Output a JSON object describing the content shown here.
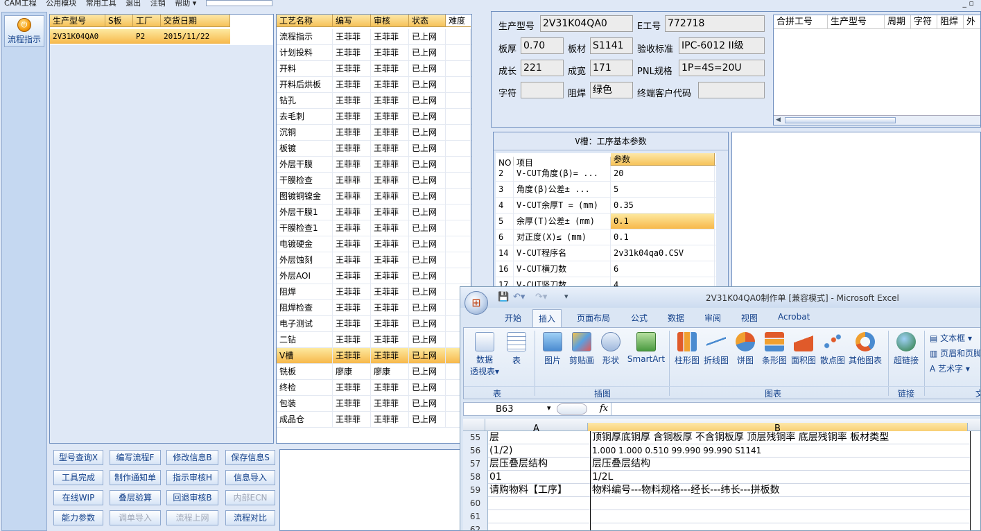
{
  "menu": {
    "items": [
      "CAM工程",
      "公用模块",
      "常用工具",
      "退出",
      "注销",
      "帮助 ▾"
    ],
    "window_controls": "_ ▫"
  },
  "leftbar": {
    "flow_button": "流程指示"
  },
  "model_table": {
    "headers": [
      "生产型号",
      "S板",
      "工厂",
      "交货日期"
    ],
    "rows": [
      [
        "2V31K04QA0",
        "",
        "P2",
        "2015/11/22"
      ]
    ]
  },
  "process_table": {
    "headers": [
      "工艺名称",
      "编写",
      "审核",
      "状态",
      "难度"
    ],
    "rows": [
      [
        "流程指示",
        "王菲菲",
        "王菲菲",
        "已上网"
      ],
      [
        "计划投料",
        "王菲菲",
        "王菲菲",
        "已上网"
      ],
      [
        "开料",
        "王菲菲",
        "王菲菲",
        "已上网"
      ],
      [
        "开料后烘板",
        "王菲菲",
        "王菲菲",
        "已上网"
      ],
      [
        "钻孔",
        "王菲菲",
        "王菲菲",
        "已上网"
      ],
      [
        "去毛刺",
        "王菲菲",
        "王菲菲",
        "已上网"
      ],
      [
        "沉铜",
        "王菲菲",
        "王菲菲",
        "已上网"
      ],
      [
        "板镀",
        "王菲菲",
        "王菲菲",
        "已上网"
      ],
      [
        "外层干膜",
        "王菲菲",
        "王菲菲",
        "已上网"
      ],
      [
        "干膜检查",
        "王菲菲",
        "王菲菲",
        "已上网"
      ],
      [
        "图镀铜镍金",
        "王菲菲",
        "王菲菲",
        "已上网"
      ],
      [
        "外层干膜1",
        "王菲菲",
        "王菲菲",
        "已上网"
      ],
      [
        "干膜检查1",
        "王菲菲",
        "王菲菲",
        "已上网"
      ],
      [
        "电镀硬金",
        "王菲菲",
        "王菲菲",
        "已上网"
      ],
      [
        "外层蚀刻",
        "王菲菲",
        "王菲菲",
        "已上网"
      ],
      [
        "外层AOI",
        "王菲菲",
        "王菲菲",
        "已上网"
      ],
      [
        "阻焊",
        "王菲菲",
        "王菲菲",
        "已上网"
      ],
      [
        "阻焊检查",
        "王菲菲",
        "王菲菲",
        "已上网"
      ],
      [
        "电子测试",
        "王菲菲",
        "王菲菲",
        "已上网"
      ],
      [
        "二钻",
        "王菲菲",
        "王菲菲",
        "已上网"
      ],
      [
        "V槽",
        "王菲菲",
        "王菲菲",
        "已上网"
      ],
      [
        "铣板",
        "廖康",
        "廖康",
        "已上网"
      ],
      [
        "终检",
        "王菲菲",
        "王菲菲",
        "已上网"
      ],
      [
        "包装",
        "王菲菲",
        "王菲菲",
        "已上网"
      ],
      [
        "成品仓",
        "王菲菲",
        "王菲菲",
        "已上网"
      ]
    ]
  },
  "buttons": [
    [
      "型号查询X",
      "编写流程F",
      "修改信息B",
      "保存信息S"
    ],
    [
      "工具完成",
      "制作通知单",
      "指示审核H",
      "信息导入"
    ],
    [
      "在线WIP",
      "叠层验算",
      "回退审核B",
      "内部ECN"
    ],
    [
      "能力参数",
      "调单导入",
      "流程上网",
      "流程对比"
    ]
  ],
  "info": {
    "model_label": "生产型号",
    "model": "2V31K04QA0",
    "e_label": "E工号",
    "e_no": "772718",
    "thick_label": "板厚",
    "thick": "0.70",
    "mat_label": "板材",
    "mat": "S1141",
    "std_label": "验收标准",
    "std": "IPC-6012 II级",
    "len_label": "成长",
    "len": "221",
    "wid_label": "成宽",
    "wid": "171",
    "pnl_label": "PNL规格",
    "pnl": "1P=4S=20U",
    "char_label": "字符",
    "char": "",
    "mask_label": "阻焊",
    "mask": "绿色",
    "cust_label": "终端客户代码",
    "cust": ""
  },
  "merge_table": {
    "headers": [
      "合拼工号",
      "生产型号",
      "周期",
      "字符",
      "阻焊",
      "外"
    ]
  },
  "param_panel": {
    "title": "V槽：工序基本参数",
    "headers": [
      "NO",
      "项目",
      "参数"
    ],
    "rows": [
      [
        "2",
        "V-CUT角度(β)=  ...",
        "20"
      ],
      [
        "3",
        "角度(β)公差±  ...",
        "5"
      ],
      [
        "4",
        "V-CUT余厚T =  (mm)",
        "0.35"
      ],
      [
        "5",
        "余厚(T)公差±  (mm)",
        "0.1"
      ],
      [
        "6",
        "对正度(X)≤ (mm)",
        "0.1"
      ],
      [
        "14",
        "V-CUT程序名",
        "2v31k04qa0.CSV"
      ],
      [
        "16",
        "V-CUT横刀数",
        "6"
      ],
      [
        "17",
        "V-CUT竖刀数",
        "4"
      ]
    ]
  },
  "excel": {
    "title": "2V31K04QA0制作单 [兼容模式] - Microsoft Excel",
    "tabs": [
      "开始",
      "插入",
      "页面布局",
      "公式",
      "数据",
      "审阅",
      "视图",
      "Acrobat"
    ],
    "ribbon": [
      "数据\n透视表▾",
      "表",
      "图片",
      "剪贴画",
      "形状",
      "SmartArt",
      "柱形图",
      "折线图",
      "饼图",
      "条形图",
      "面积图",
      "散点图",
      "其他图表",
      "超链接"
    ],
    "right_items": [
      "文本框 ▾",
      "页眉和页脚",
      "艺术字 ▾"
    ],
    "groups": [
      "表",
      "插图",
      "图表",
      "链接",
      "文"
    ],
    "namebox": "B63",
    "fx": "fx",
    "col_a": "A",
    "col_b": "B",
    "rows": [
      [
        "55",
        "层",
        "顶铜厚底铜厚 含铜板厚 不含铜板厚 顶层残铜率 底层残铜率 板材类型"
      ],
      [
        "56",
        "(1/2)",
        "1.000  1.000          0.510       99.990      99.990      S1141"
      ],
      [
        "57",
        "层压叠层结构",
        "层压叠层结构"
      ],
      [
        "58",
        "01",
        "1/2L"
      ],
      [
        "59",
        "请购物料【工序】",
        "物料编号---物料规格---经长---纬长---拼板数"
      ],
      [
        "60",
        "",
        ""
      ],
      [
        "61",
        "",
        ""
      ],
      [
        "62",
        "",
        ""
      ]
    ]
  },
  "colors": {
    "accent": "#f6c35a",
    "panel_border": "#6f8fbf"
  }
}
